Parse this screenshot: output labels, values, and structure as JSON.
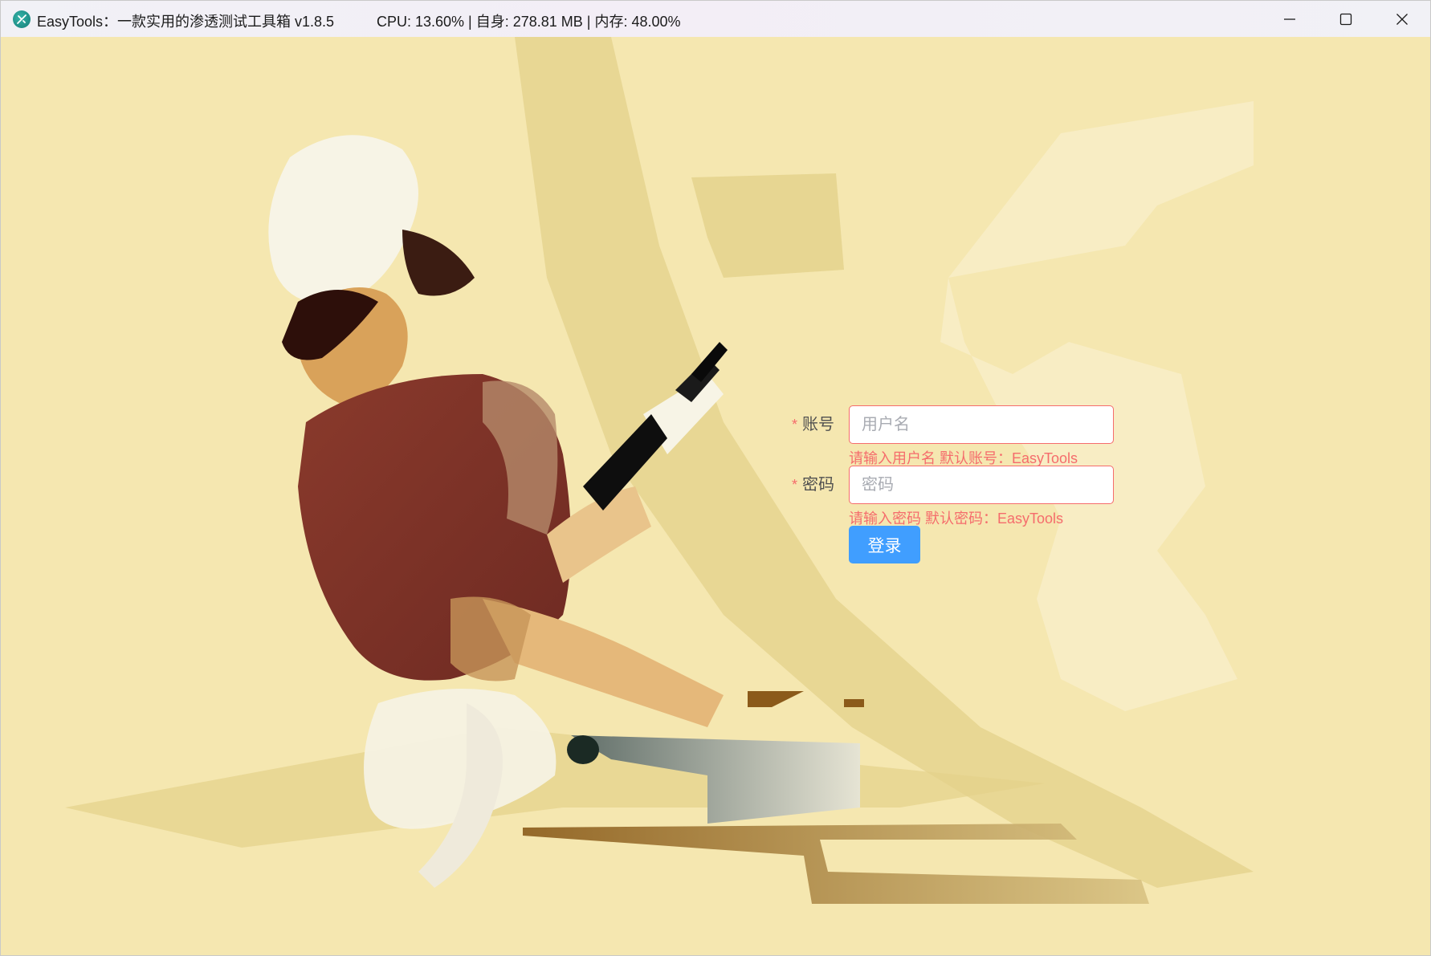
{
  "window": {
    "title": "EasyTools：一款实用的渗透测试工具箱  v1.8.5",
    "stats": "CPU: 13.60% | 自身: 278.81 MB | 内存: 48.00%"
  },
  "icons": {
    "app": "app-logo-icon",
    "minimize": "minimize-icon",
    "maximize": "maximize-icon",
    "close": "close-icon"
  },
  "login": {
    "account_label": "账号",
    "account_placeholder": "用户名",
    "account_error": "请输入用户名 默认账号：EasyTools",
    "password_label": "密码",
    "password_placeholder": "密码",
    "password_error": "请输入密码 默认密码：EasyTools",
    "submit_label": "登录",
    "required_mark": "*"
  },
  "colors": {
    "background": "#f5e7b0",
    "primary_button": "#409eff",
    "error": "#f56c6c"
  }
}
